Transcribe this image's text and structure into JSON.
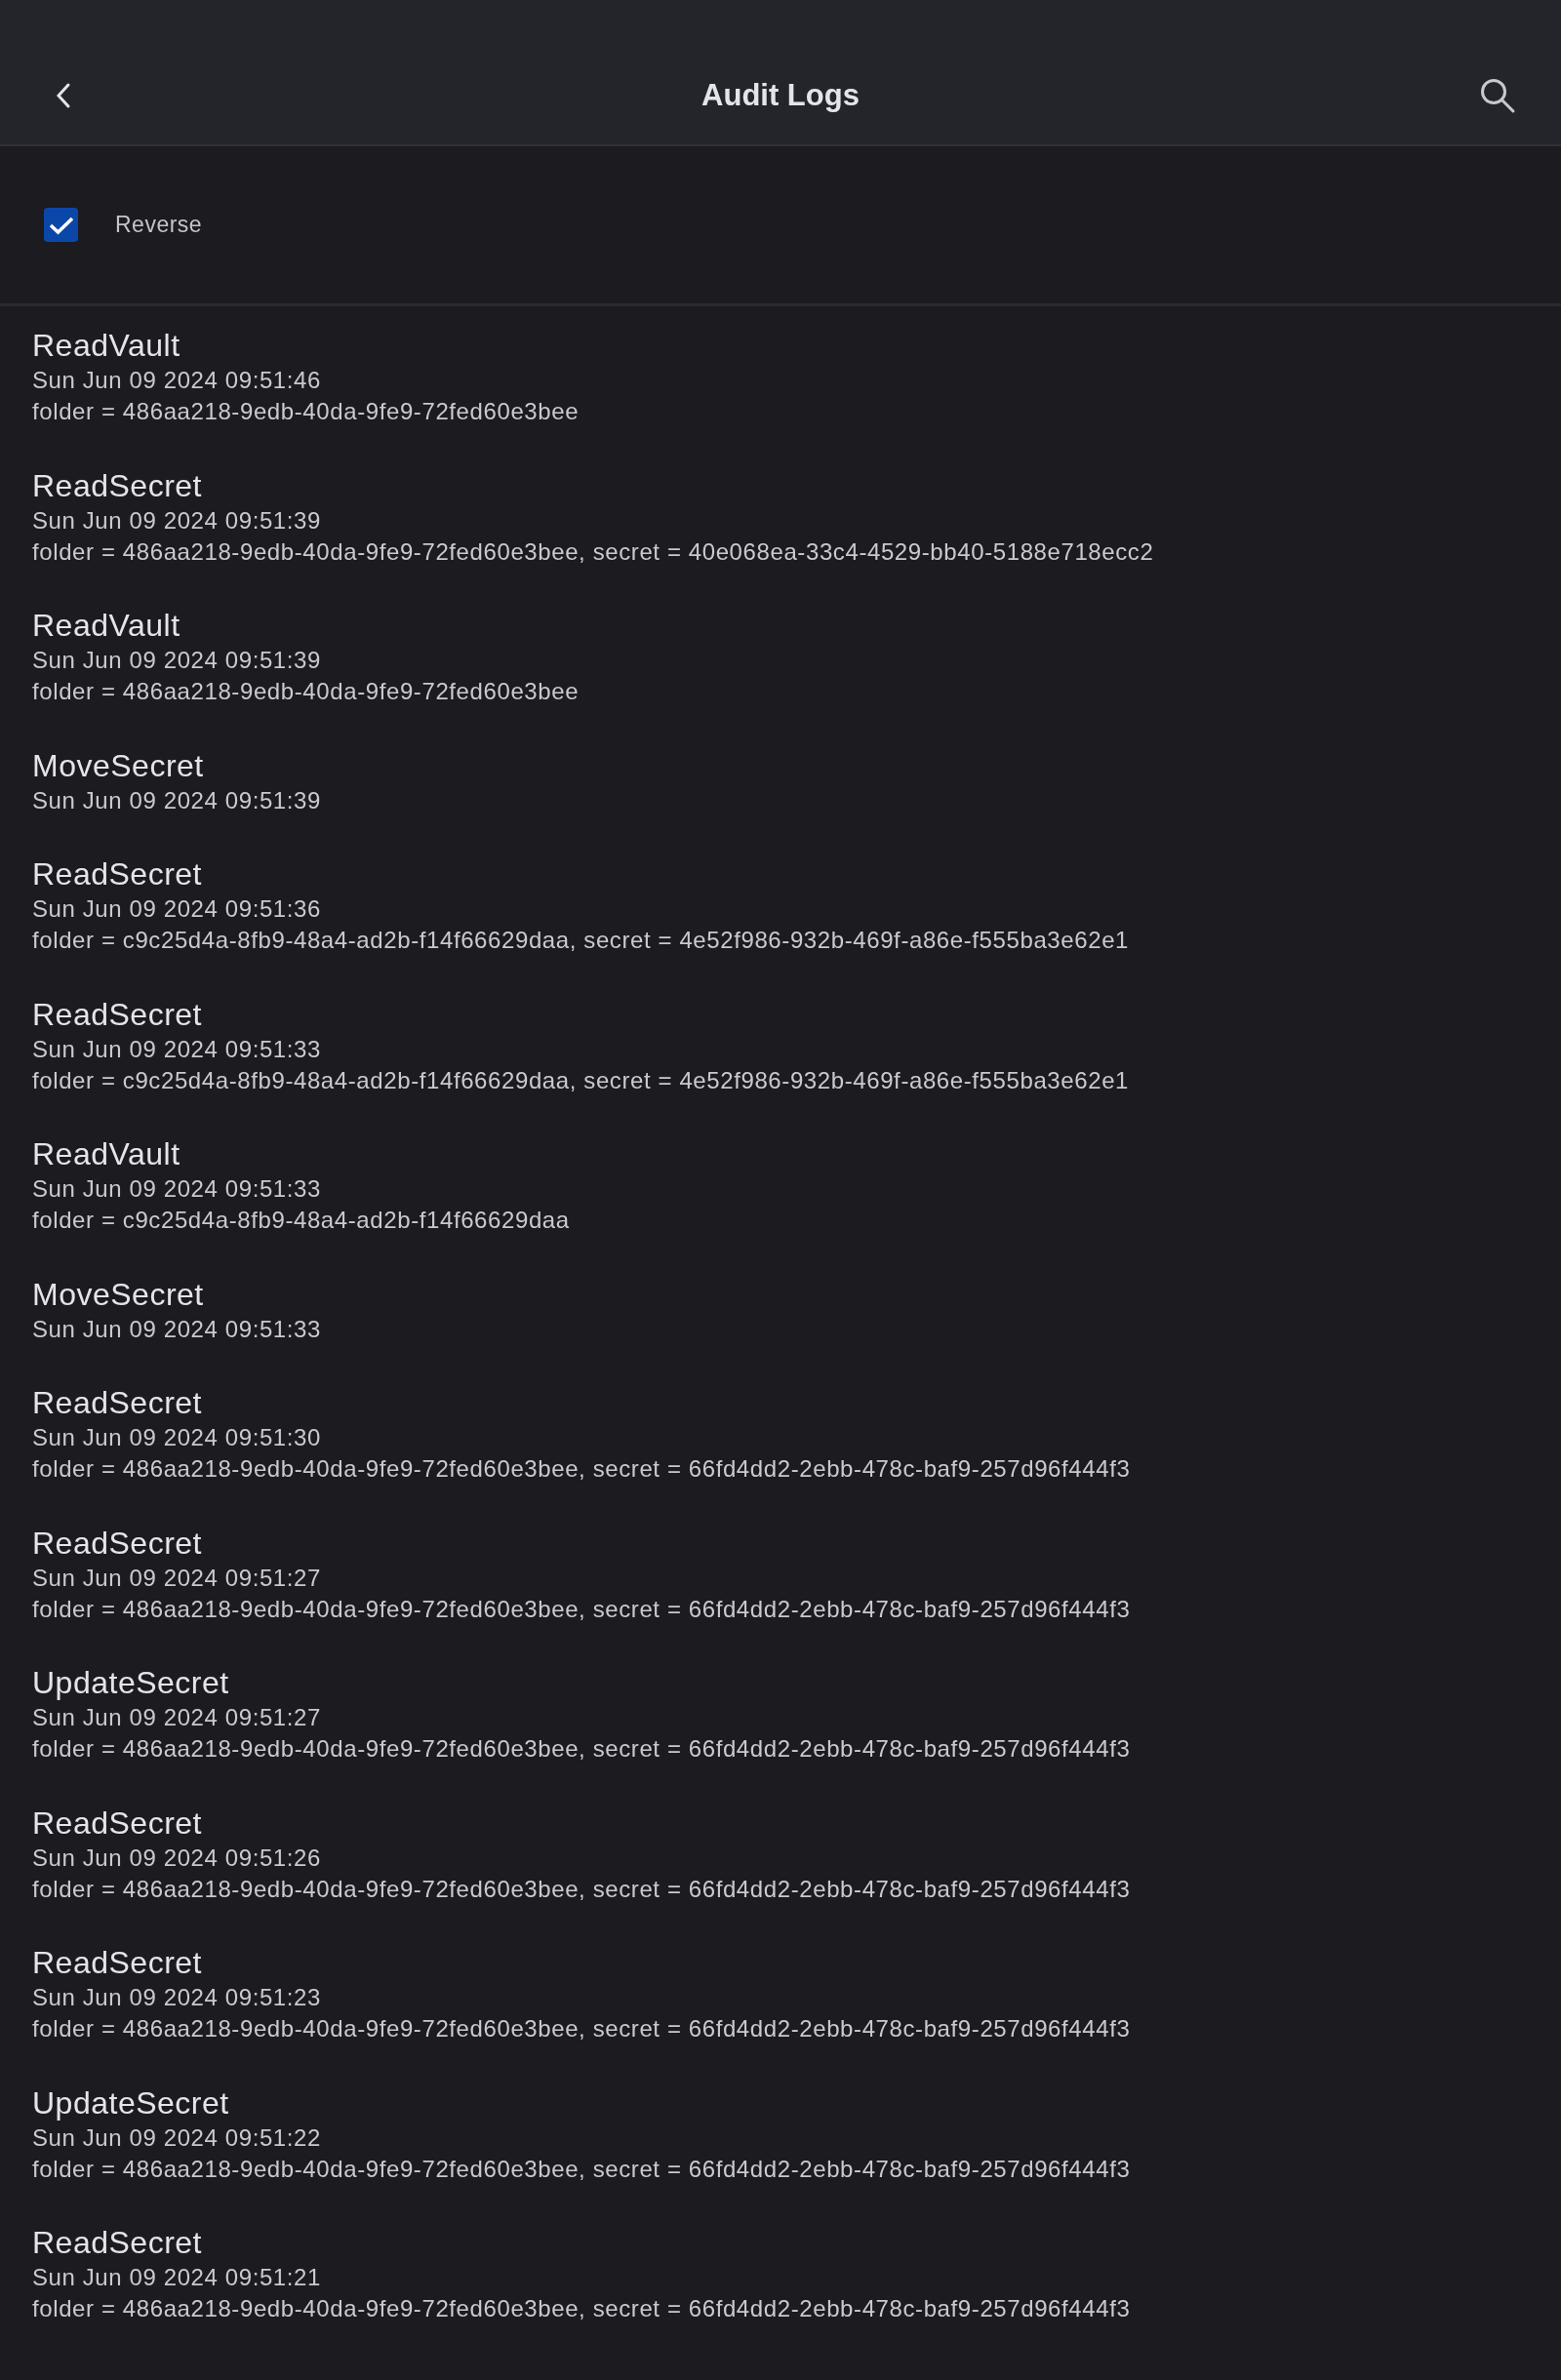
{
  "app_bar": {
    "title": "Audit Logs"
  },
  "filter": {
    "label": "Reverse",
    "checked": true
  },
  "entries": [
    {
      "event": "ReadVault",
      "time": "Sun Jun 09 2024 09:51:46",
      "details": "folder = 486aa218-9edb-40da-9fe9-72fed60e3bee"
    },
    {
      "event": "ReadSecret",
      "time": "Sun Jun 09 2024 09:51:39",
      "details": "folder = 486aa218-9edb-40da-9fe9-72fed60e3bee, secret = 40e068ea-33c4-4529-bb40-5188e718ecc2"
    },
    {
      "event": "ReadVault",
      "time": "Sun Jun 09 2024 09:51:39",
      "details": "folder = 486aa218-9edb-40da-9fe9-72fed60e3bee"
    },
    {
      "event": "MoveSecret",
      "time": "Sun Jun 09 2024 09:51:39"
    },
    {
      "event": "ReadSecret",
      "time": "Sun Jun 09 2024 09:51:36",
      "details": "folder = c9c25d4a-8fb9-48a4-ad2b-f14f66629daa, secret = 4e52f986-932b-469f-a86e-f555ba3e62e1"
    },
    {
      "event": "ReadSecret",
      "time": "Sun Jun 09 2024 09:51:33",
      "details": "folder = c9c25d4a-8fb9-48a4-ad2b-f14f66629daa, secret = 4e52f986-932b-469f-a86e-f555ba3e62e1"
    },
    {
      "event": "ReadVault",
      "time": "Sun Jun 09 2024 09:51:33",
      "details": "folder = c9c25d4a-8fb9-48a4-ad2b-f14f66629daa"
    },
    {
      "event": "MoveSecret",
      "time": "Sun Jun 09 2024 09:51:33"
    },
    {
      "event": "ReadSecret",
      "time": "Sun Jun 09 2024 09:51:30",
      "details": "folder = 486aa218-9edb-40da-9fe9-72fed60e3bee, secret = 66fd4dd2-2ebb-478c-baf9-257d96f444f3"
    },
    {
      "event": "ReadSecret",
      "time": "Sun Jun 09 2024 09:51:27",
      "details": "folder = 486aa218-9edb-40da-9fe9-72fed60e3bee, secret = 66fd4dd2-2ebb-478c-baf9-257d96f444f3"
    },
    {
      "event": "UpdateSecret",
      "time": "Sun Jun 09 2024 09:51:27",
      "details": "folder = 486aa218-9edb-40da-9fe9-72fed60e3bee, secret = 66fd4dd2-2ebb-478c-baf9-257d96f444f3"
    },
    {
      "event": "ReadSecret",
      "time": "Sun Jun 09 2024 09:51:26",
      "details": "folder = 486aa218-9edb-40da-9fe9-72fed60e3bee, secret = 66fd4dd2-2ebb-478c-baf9-257d96f444f3"
    },
    {
      "event": "ReadSecret",
      "time": "Sun Jun 09 2024 09:51:23",
      "details": "folder = 486aa218-9edb-40da-9fe9-72fed60e3bee, secret = 66fd4dd2-2ebb-478c-baf9-257d96f444f3"
    },
    {
      "event": "UpdateSecret",
      "time": "Sun Jun 09 2024 09:51:22",
      "details": "folder = 486aa218-9edb-40da-9fe9-72fed60e3bee, secret = 66fd4dd2-2ebb-478c-baf9-257d96f444f3"
    },
    {
      "event": "ReadSecret",
      "time": "Sun Jun 09 2024 09:51:21",
      "details": "folder = 486aa218-9edb-40da-9fe9-72fed60e3bee, secret = 66fd4dd2-2ebb-478c-baf9-257d96f444f3"
    }
  ]
}
